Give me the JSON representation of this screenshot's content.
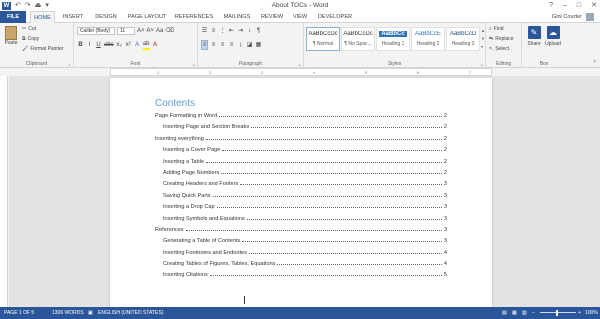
{
  "window": {
    "title": "About TOCs - Word",
    "user": "Gini Courter",
    "controls": [
      "?",
      "–",
      "□",
      "✕"
    ]
  },
  "qat": [
    "↶",
    "↷",
    "⏏",
    "▾"
  ],
  "tabs": [
    "FILE",
    "HOME",
    "INSERT",
    "DESIGN",
    "PAGE LAYOUT",
    "REFERENCES",
    "MAILINGS",
    "REVIEW",
    "VIEW",
    "DEVELOPER"
  ],
  "ribbon": {
    "clipboard": {
      "label": "Clipboard",
      "paste": "Paste",
      "cut": "Cut",
      "copy": "Copy",
      "format_painter": "Format Painter"
    },
    "font": {
      "label": "Font",
      "font_name": "Calibri (Body)",
      "font_size": "11"
    },
    "paragraph": {
      "label": "Paragraph"
    },
    "styles": {
      "label": "Styles",
      "items": [
        {
          "preview": "AaBbCcDc",
          "name": "¶ Normal"
        },
        {
          "preview": "AaBbCcDc",
          "name": "¶ No Spac..."
        },
        {
          "preview": "AaBbCc",
          "name": "Heading 1"
        },
        {
          "preview": "AaBbCcE",
          "name": "Heading 2"
        },
        {
          "preview": "AaBbCcD",
          "name": "Heading 3"
        }
      ]
    },
    "editing": {
      "label": "Editing",
      "find": "Find",
      "replace": "Replace",
      "select": "Select"
    },
    "box": {
      "label": "Box",
      "share": "Share",
      "upload": "Upload"
    }
  },
  "ruler_marks": [
    "1",
    "2",
    "3",
    "4",
    "5",
    "6",
    "7"
  ],
  "document": {
    "toc_title": "Contents",
    "entries": [
      {
        "level": 1,
        "text": "Page Formatting in Word",
        "page": "2"
      },
      {
        "level": 2,
        "text": "Inserting Page and Section Breaks",
        "page": "2"
      },
      {
        "level": 1,
        "text": "Inserting everything",
        "page": "2"
      },
      {
        "level": 2,
        "text": "Inserting a Cover Page",
        "page": "2"
      },
      {
        "level": 2,
        "text": "Inserting a Table",
        "page": "2"
      },
      {
        "level": 2,
        "text": "Adding Page Numbers",
        "page": "2"
      },
      {
        "level": 2,
        "text": "Creating Headers and Footers",
        "page": "3"
      },
      {
        "level": 2,
        "text": "Saving Quick Parts",
        "page": "3"
      },
      {
        "level": 2,
        "text": "Inserting a Drop Cap",
        "page": "3"
      },
      {
        "level": 2,
        "text": "Inserting Symbols and Equations",
        "page": "3"
      },
      {
        "level": 1,
        "text": "References",
        "page": "3"
      },
      {
        "level": 2,
        "text": "Generating a Table of Contents",
        "page": "3"
      },
      {
        "level": 2,
        "text": "Inserting Footnotes and Endnotes",
        "page": "4"
      },
      {
        "level": 2,
        "text": "Creating Tables of Figures, Tables, Equations",
        "page": "4"
      },
      {
        "level": 2,
        "text": "Inserting Citations",
        "page": "5"
      }
    ]
  },
  "status": {
    "page": "PAGE 1 OF 5",
    "words": "1306 WORDS",
    "language": "ENGLISH (UNITED STATES)",
    "zoom": "100%"
  }
}
